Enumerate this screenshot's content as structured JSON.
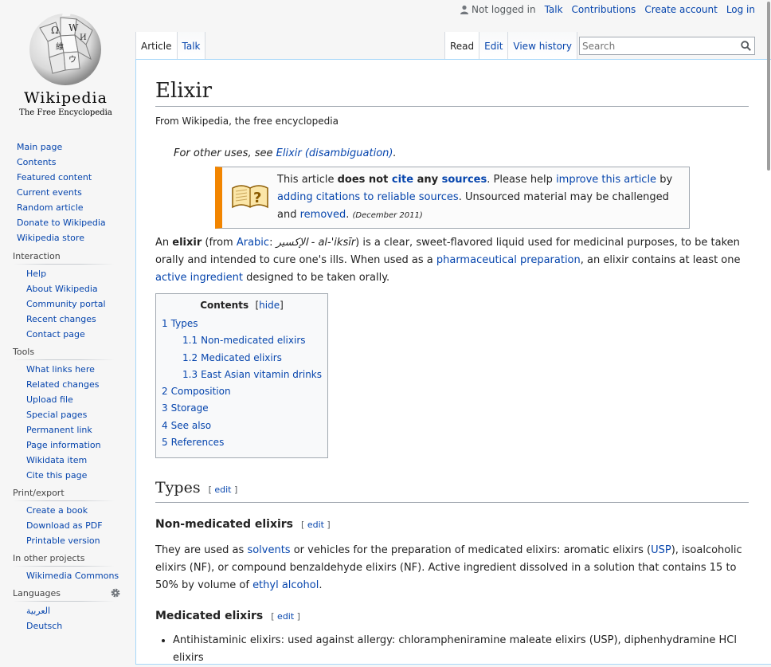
{
  "personal": {
    "not_logged_in": "Not logged in",
    "talk": "Talk",
    "contributions": "Contributions",
    "create_account": "Create account",
    "log_in": "Log in"
  },
  "logo": {
    "wordmark": "Wikipedia",
    "tagline": "The Free Encyclopedia"
  },
  "navigation": [
    "Main page",
    "Contents",
    "Featured content",
    "Current events",
    "Random article",
    "Donate to Wikipedia",
    "Wikipedia store"
  ],
  "interaction": {
    "heading": "Interaction",
    "items": [
      "Help",
      "About Wikipedia",
      "Community portal",
      "Recent changes",
      "Contact page"
    ]
  },
  "tools": {
    "heading": "Tools",
    "items": [
      "What links here",
      "Related changes",
      "Upload file",
      "Special pages",
      "Permanent link",
      "Page information",
      "Wikidata item",
      "Cite this page"
    ]
  },
  "print": {
    "heading": "Print/export",
    "items": [
      "Create a book",
      "Download as PDF",
      "Printable version"
    ]
  },
  "projects": {
    "heading": "In other projects",
    "items": [
      "Wikimedia Commons"
    ]
  },
  "languages": {
    "heading": "Languages",
    "items": [
      "العربية",
      "Deutsch"
    ]
  },
  "tabs": {
    "article": "Article",
    "talk": "Talk",
    "read": "Read",
    "edit": "Edit",
    "history": "View history"
  },
  "search": {
    "placeholder": "Search"
  },
  "article": {
    "title": "Elixir",
    "site_sub": "From Wikipedia, the free encyclopedia",
    "hatnote_prefix": "For other uses, see ",
    "hatnote_link": "Elixir (disambiguation)",
    "hatnote_suffix": ".",
    "ambox": {
      "t1": "This article ",
      "t2": "does not ",
      "t3": "cite",
      "t4": " any ",
      "t5": "sources",
      "t6": ". Please help ",
      "t7": "improve this article",
      "t8": " by ",
      "t9": "adding citations to reliable sources",
      "t10": ". Unsourced material may be challenged and ",
      "t11": "removed",
      "t12": ".",
      "date": "(December 2011)"
    },
    "lead": {
      "l1": "An ",
      "l2": "elixir",
      "l3": " (from ",
      "l4": "Arabic",
      "l5": ": ",
      "l6": "الإكسير",
      "l7": " - al-'iksīr",
      "l8": ") is a clear, sweet-flavored liquid used for medicinal purposes, to be taken orally and intended to cure one's ills. When used as a ",
      "l9": "pharmaceutical preparation",
      "l10": ", an elixir contains at least one ",
      "l11": "active ingredient",
      "l12": " designed to be taken orally."
    },
    "toc": {
      "title": "Contents",
      "hide": "hide",
      "items": [
        {
          "num": "1",
          "label": "Types"
        },
        {
          "num": "1.1",
          "label": "Non-medicated elixirs"
        },
        {
          "num": "1.2",
          "label": "Medicated elixirs"
        },
        {
          "num": "1.3",
          "label": "East Asian vitamin drinks"
        },
        {
          "num": "2",
          "label": "Composition"
        },
        {
          "num": "3",
          "label": "Storage"
        },
        {
          "num": "4",
          "label": "See also"
        },
        {
          "num": "5",
          "label": "References"
        }
      ]
    },
    "types_heading": "Types",
    "edit": "edit",
    "nonmed_heading": "Non-medicated elixirs",
    "nonmed": {
      "n1": "They are used as ",
      "n2": "solvents",
      "n3": " or vehicles for the preparation of medicated elixirs: aromatic elixirs (",
      "n4": "USP",
      "n5": "), isoalcoholic elixirs (NF), or compound benzaldehyde elixirs (NF). Active ingredient dissolved in a solution that contains 15 to 50% by volume of ",
      "n6": "ethyl alcohol",
      "n7": "."
    },
    "med_heading": "Medicated elixirs",
    "med_bullet": "Antihistaminic elixirs: used against allergy: chlorampheniramine maleate elixirs (USP), diphenhydramine HCl elixirs"
  }
}
